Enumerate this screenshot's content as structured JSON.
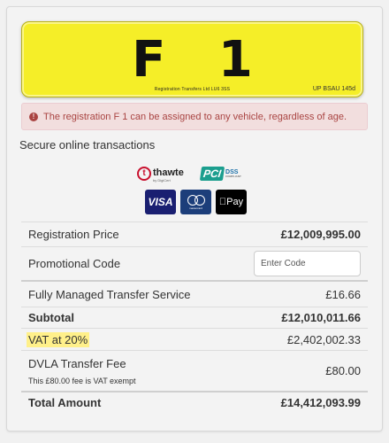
{
  "plate": {
    "registration": "F 1",
    "dealer_line": "Registration Transfers Ltd LU6 3SS",
    "code": "UP BSAU 145d",
    "background_color": "#f5ee28"
  },
  "alert": {
    "icon": "exclamation-circle-icon",
    "message": "The registration F 1 can be assigned to any vehicle, regardless of age."
  },
  "secure": {
    "title": "Secure online transactions",
    "thawte_name": "thawte",
    "thawte_sub": "by DigiCert",
    "pci_label": "PCI",
    "pci_dss": "DSS",
    "pci_sub": "COMPLIANT",
    "visa_label": "VISA",
    "mastercard_label": "mastercard",
    "applepay_label": " Pay"
  },
  "pricing": {
    "registration_price_label": "Registration Price",
    "registration_price_value": "£12,009,995.00",
    "promo_label": "Promotional Code",
    "promo_placeholder": "Enter Code",
    "transfer_label": "Fully Managed Transfer Service",
    "transfer_value": "£16.66",
    "subtotal_label": "Subtotal",
    "subtotal_value": "£12,010,011.66",
    "vat_label": "VAT at 20%",
    "vat_value": "£2,402,002.33",
    "dvla_label": "DVLA Transfer Fee",
    "dvla_note": "This £80.00 fee is VAT exempt",
    "dvla_value": "£80.00",
    "total_label": "Total Amount",
    "total_value": "£14,412,093.99"
  }
}
